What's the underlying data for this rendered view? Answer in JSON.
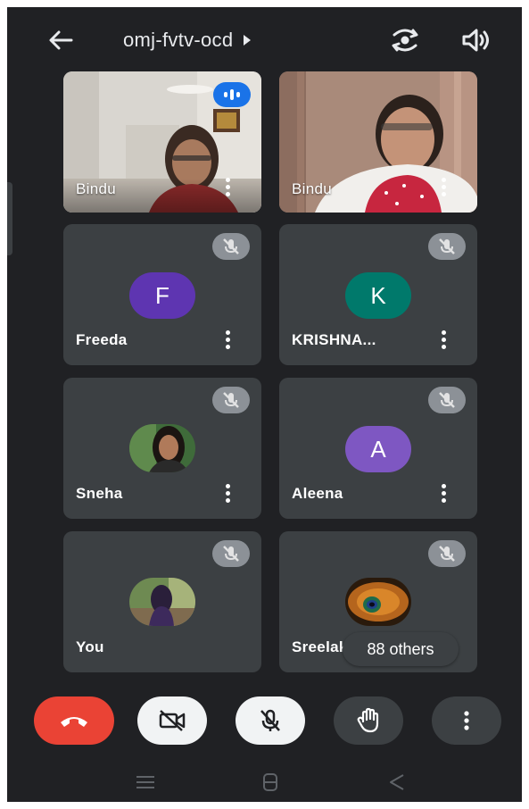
{
  "meeting": {
    "code": "omj-fvtv-ocd"
  },
  "icons": {
    "back": "arrow-back-icon",
    "title_expand": "caret-right-icon",
    "switch_camera": "switch-camera-icon",
    "audio_output": "speaker-icon",
    "tile_more": "more-vert-icon",
    "muted": "mic-off-icon",
    "speaking": "audio-level-icon"
  },
  "tiles": [
    {
      "name": "Bindu",
      "kind": "video",
      "speaking": true
    },
    {
      "name": "Bindu",
      "kind": "video",
      "speaking": false
    },
    {
      "name": "Freeda",
      "kind": "initial",
      "initial": "F",
      "color": "#5e35b1",
      "muted": true
    },
    {
      "name": "KRISHNA...",
      "kind": "initial",
      "initial": "K",
      "color": "#00796b",
      "muted": true
    },
    {
      "name": "Sneha",
      "kind": "photo",
      "muted": true
    },
    {
      "name": "Aleena",
      "kind": "initial",
      "initial": "A",
      "color": "#7e57c2",
      "muted": true
    },
    {
      "name": "You",
      "kind": "photo",
      "muted": true
    },
    {
      "name": "Sreelak",
      "kind": "photo",
      "muted": true
    }
  ],
  "others": {
    "label": "88 others"
  },
  "controls": [
    {
      "name": "end-call",
      "icon": "call-end-icon",
      "color": "#ea4335"
    },
    {
      "name": "camera-off",
      "icon": "videocam-off-icon",
      "color": "#f1f3f4"
    },
    {
      "name": "mic-off",
      "icon": "mic-off-icon",
      "color": "#f1f3f4"
    },
    {
      "name": "raise-hand",
      "icon": "hand-icon",
      "color": "#3c4043"
    },
    {
      "name": "more-options",
      "icon": "more-vert-icon",
      "color": "#3c4043"
    }
  ],
  "navbar": [
    "recent-apps-icon",
    "home-icon",
    "back-nav-icon"
  ]
}
